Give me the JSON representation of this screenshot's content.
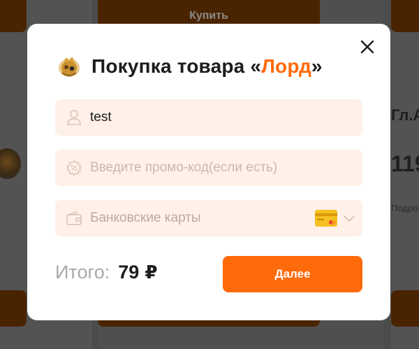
{
  "background": {
    "buy_button_label": "Купить",
    "right_title_partial": "Гл.А",
    "right_price_partial": "119",
    "right_link_partial": "Подро"
  },
  "modal": {
    "title_prefix": "Покупка товара «",
    "product_name": "Лорд",
    "title_suffix": "»",
    "name_field": {
      "value": "test",
      "icon": "user-icon"
    },
    "promo_field": {
      "placeholder": "Введите промо-код(если есть)",
      "icon": "percent-badge-icon"
    },
    "payment_select": {
      "selected": "Банковские карты",
      "icon": "wallet-icon",
      "method_icon": "bank-card-icon"
    },
    "total": {
      "label": "Итого:",
      "amount": "79",
      "currency": "₽"
    },
    "next_button_label": "Далее"
  },
  "colors": {
    "accent": "#ff6a0a",
    "field_bg": "#fff0e8",
    "overlay": "#4b4b4b"
  }
}
